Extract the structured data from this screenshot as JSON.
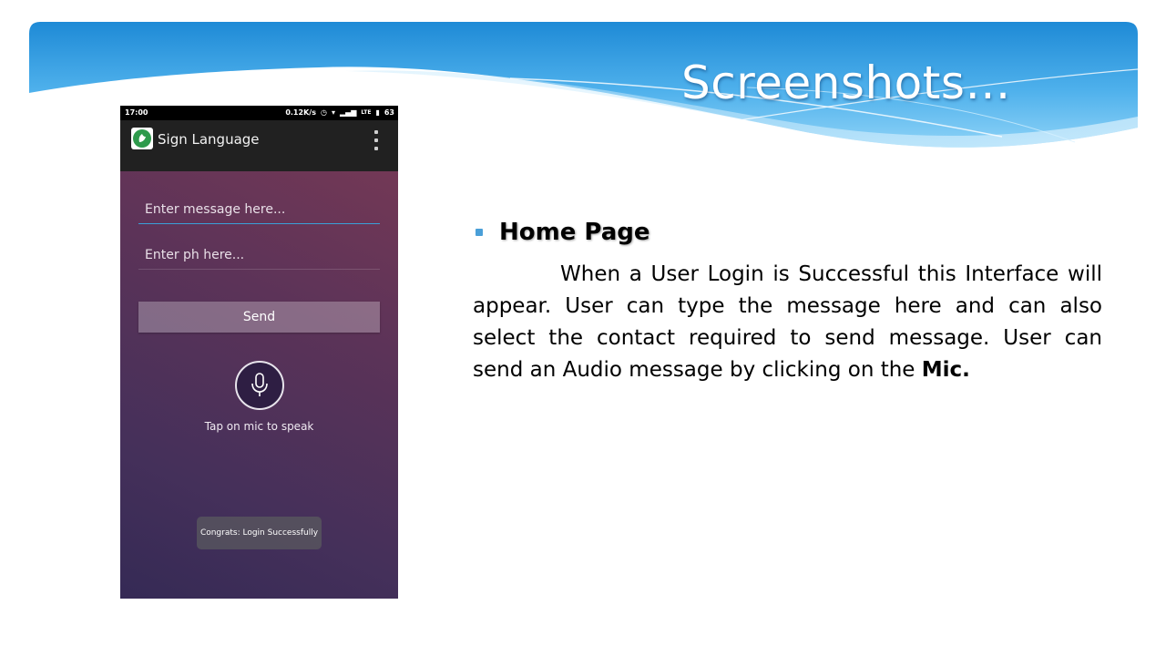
{
  "slide": {
    "title": "Screenshots…",
    "accent_color": "#4a9fd8"
  },
  "phone": {
    "status": {
      "time": "17:00",
      "speed": "0.12K/s",
      "network": "LTE",
      "battery": "63"
    },
    "app_title": "Sign Language",
    "message_placeholder": "Enter message here...",
    "phone_placeholder": "Enter ph here...",
    "send_label": "Send",
    "mic_caption": "Tap on mic to speak",
    "toast": "Congrats: Login Successfully",
    "icons": [
      "app-logo-icon",
      "overflow-menu-icon",
      "mic-icon",
      "alarm-icon",
      "wifi-icon",
      "signal-icon",
      "battery-icon"
    ]
  },
  "content": {
    "heading": "Home Page",
    "paragraph": "When a User Login is Successful this Interface will appear. User can type the message here and can also select the contact required to send message. User can send an Audio message by clicking on the",
    "emphasis": "Mic."
  }
}
